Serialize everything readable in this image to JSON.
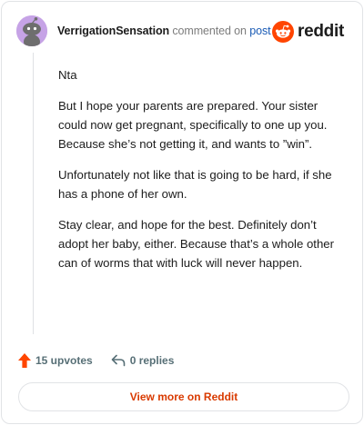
{
  "header": {
    "username": "VerrigationSensation",
    "verb": "commented on",
    "target": "post",
    "brand_name": "reddit",
    "brand_color": "#ff4500"
  },
  "comment": {
    "paragraphs": [
      "Nta",
      "But I hope your parents are prepared. Your sister could now get pregnant, specifically to one up you. Because she’s not getting it, and wants to ”win”.",
      "Unfortunately not like that is going to be hard, if she has a phone of her own.",
      "Stay clear, and hope for the best. Definitely don’t adopt her baby, either. Because that’s a whole other can of worms that with luck will never happen."
    ]
  },
  "actions": {
    "upvotes_label": "15 upvotes",
    "upvote_icon": "arrow-up-icon",
    "upvote_color": "#ff4500",
    "replies_label": "0 replies",
    "reply_icon": "reply-arrow-icon"
  },
  "footer": {
    "view_more_label": "View more on Reddit",
    "accent_color": "#d93a00"
  }
}
